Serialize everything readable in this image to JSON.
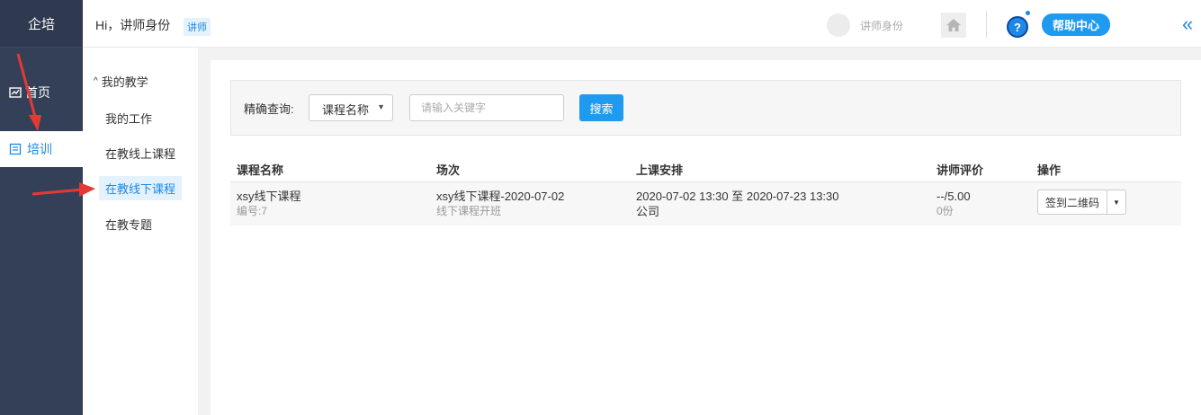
{
  "brand": "企培",
  "leftnav": {
    "items": [
      {
        "label": "首页"
      },
      {
        "label": "培训"
      }
    ]
  },
  "header": {
    "greeting": "Hi，讲师身份",
    "role_tag": "讲师",
    "identity": "讲师身份",
    "help_label": "帮助中心",
    "help_q": "?"
  },
  "subnav": {
    "group": "我的教学",
    "items": [
      {
        "label": "我的工作"
      },
      {
        "label": "在教线上课程"
      },
      {
        "label": "在教线下课程"
      },
      {
        "label": "在教专题"
      }
    ]
  },
  "filter": {
    "label": "精确查询:",
    "select_value": "课程名称",
    "input_placeholder": "请输入关键字",
    "search_label": "搜索"
  },
  "table": {
    "headers": [
      "课程名称",
      "场次",
      "上课安排",
      "讲师评价",
      "操作"
    ],
    "rows": [
      {
        "name": "xsy线下课程",
        "code": "编号:7",
        "session": "xsy线下课程-2020-07-02",
        "session_sub": "线下课程开班",
        "schedule": "2020-07-02 13:30 至 2020-07-23 13:30",
        "location": "公司",
        "rating": "--/5.00",
        "rating_sub": "0份",
        "action": "签到二维码"
      }
    ]
  },
  "colors": {
    "nav_bg": "#344058",
    "accent": "#1e9aef",
    "annotation": "#e53935"
  }
}
